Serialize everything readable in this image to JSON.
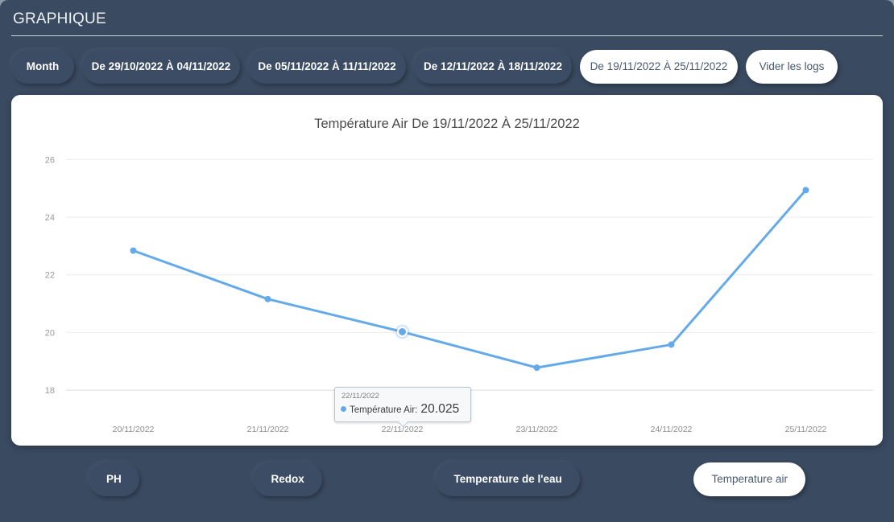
{
  "panel": {
    "title": "GRAPHIQUE"
  },
  "range_bar": {
    "buttons": [
      {
        "label": "Month",
        "name": "month-button",
        "active": false
      },
      {
        "label": "De 29/10/2022 À 04/11/2022",
        "name": "range-button-1",
        "active": false
      },
      {
        "label": "De 05/11/2022 À 11/11/2022",
        "name": "range-button-2",
        "active": false
      },
      {
        "label": "De 12/11/2022 À 18/11/2022",
        "name": "range-button-3",
        "active": false
      },
      {
        "label": "De 19/11/2022 À 25/11/2022",
        "name": "range-button-4",
        "active": true
      },
      {
        "label": "Vider les logs",
        "name": "clear-logs-button",
        "active": false
      }
    ],
    "month_label": "Month",
    "range_1": "De 29/10/2022 À 04/11/2022",
    "range_2": "De 05/11/2022 À 11/11/2022",
    "range_3": "De 12/11/2022 À 18/11/2022",
    "range_4": "De 19/11/2022 À 25/11/2022",
    "clear_logs": "Vider les logs"
  },
  "metric_bar": {
    "ph": "PH",
    "redox": "Redox",
    "water_temp": "Temperature de l'eau",
    "air_temp": "Temperature air",
    "active": "Temperature air"
  },
  "tooltip": {
    "date": "22/11/2022",
    "series_label": "Température Air:",
    "value": "20.025",
    "marker_color": "#65aae8"
  },
  "colors": {
    "background": "#3a4a61",
    "card": "#ffffff",
    "series": "#65aae8",
    "pill": "#3c4c64",
    "pill_active_text": "#48586f",
    "grid": "#ececec"
  },
  "chart_data": {
    "type": "line",
    "title": "Température Air De 19/11/2022 À 25/11/2022",
    "xlabel": "",
    "ylabel": "",
    "categories": [
      "20/11/2022",
      "21/11/2022",
      "22/11/2022",
      "23/11/2022",
      "24/11/2022",
      "25/11/2022"
    ],
    "series": [
      {
        "name": "Température Air",
        "color": "#65aae8",
        "values": [
          22.84,
          21.16,
          20.025,
          18.78,
          19.58,
          24.94
        ]
      }
    ],
    "yticks": [
      18,
      20,
      22,
      24,
      26
    ],
    "ylim": [
      17.5,
      26.4
    ],
    "grid": true,
    "legend": false,
    "highlight_index": 2
  }
}
